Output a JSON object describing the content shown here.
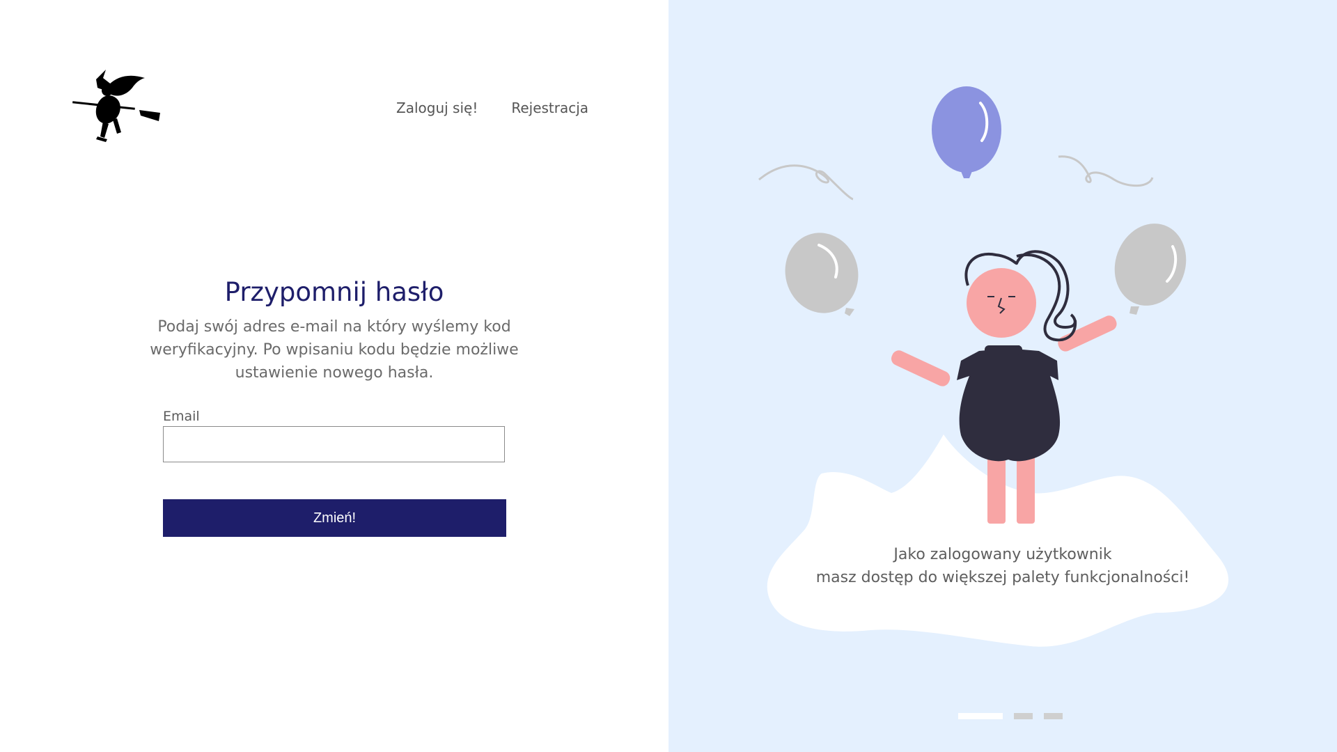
{
  "nav": {
    "login_label": "Zaloguj się!",
    "register_label": "Rejestracja"
  },
  "form": {
    "title": "Przypomnij hasło",
    "description": "Podaj swój adres e-mail na który wyślemy kod weryfikacyjny. Po wpisaniu kodu będzie możliwe ustawienie nowego hasła.",
    "email_label": "Email",
    "email_value": "",
    "submit_label": "Zmień!"
  },
  "promo": {
    "line1": "Jako zalogowany użytkownik",
    "line2": "masz dostęp do większej palety funkcjonalności!",
    "slides_total": 3,
    "slide_active": 1
  },
  "colors": {
    "brand_navy": "#1e1e6a",
    "panel_bg": "#e4f0fe",
    "balloon_blue": "#8b93e0",
    "balloon_gray": "#c8c8c8",
    "skin": "#f8a5a5",
    "dress": "#2f2d3e"
  },
  "icons": {
    "logo": "witch-on-broom-icon"
  }
}
